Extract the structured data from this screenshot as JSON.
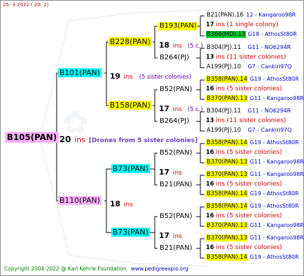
{
  "header": {
    "date": "25-   3-2022 ( 20:   2)"
  },
  "footer": {
    "copyright": "Copyright 2004-2022 @ Karl Kehrle Foundation",
    "url": "www.pedigreeapis.org"
  },
  "root": {
    "id": "B105(PAN)",
    "ins_num": "20",
    "ins_label": "ins",
    "note": "[Drones from 5 sister colonies]"
  },
  "gen1": [
    {
      "id": "B101(PAN)",
      "ins_num": "19",
      "ins_label": "ins",
      "note": "(5 sister colonies)"
    },
    {
      "id": "B110(PAN)",
      "ins_num": "18",
      "ins_label": "ins",
      "note": ""
    }
  ],
  "gen2": [
    {
      "id": "B228(PAN)",
      "ins_num": "18",
      "ins_label": "ins",
      "note": "(5 c.)"
    },
    {
      "id": "B158(PAN)",
      "ins_num": "17",
      "ins_label": "ins",
      "note": "(5 c.)"
    },
    {
      "id": "B73(PAN)",
      "ins_num": "17",
      "ins_label": "ins",
      "note": ""
    },
    {
      "id": "B73(PAN)",
      "ins_num": "17",
      "ins_label": "ins",
      "note": ""
    }
  ],
  "gen3": [
    "B193(PAN)",
    "B264(PJ)",
    "B52(PAN)",
    "B264(PJ)",
    "B52(PAN)",
    "B21(PAN)",
    "B52(PAN)",
    "B21(PAN)"
  ],
  "leaves": [
    {
      "a": "B21(PAN).16",
      "code_a": "12 - Kangaroo98R",
      "ins_num": "17",
      "ins_note": "ins (1 single colony)",
      "b": "B366(MD).13",
      "code_b": "G18 - AthosSt80R"
    },
    {
      "a": "B304(PJ).11",
      "code_a": "G11 - NO6294R",
      "ins_num": "13",
      "ins_note": "ins (11 sister colonies)",
      "b": "A199(PJ).10",
      "code_b": "G7 - Cankiri97Q"
    },
    {
      "a": "B358(PAN).14",
      "code_a": "G19 - AthosSt80R",
      "ins_num": "16",
      "ins_note": "ins (5 sister colonies)",
      "b": "B370(PAN).13",
      "code_b": "G11 - Kangaroo98R"
    },
    {
      "a": "B304(PJ).11",
      "code_a": "G11 - NO6294R",
      "ins_num": "13",
      "ins_note": "ins (11 sister colonies)",
      "b": "A199(PJ).10",
      "code_b": "G7 - Cankiri97Q"
    },
    {
      "a": "B358(PAN).14",
      "code_a": "G19 - AthosSt80R",
      "ins_num": "16",
      "ins_note": "ins (5 sister colonies)",
      "b": "B370(PAN).13",
      "code_b": "G11 - Kangaroo98R"
    },
    {
      "a": "B370(PAN).13",
      "code_a": "G11 - Kangaroo98R",
      "ins_num": "16",
      "ins_note": "ins (5 sister colonies)",
      "b": "B358(PAN).14",
      "code_b": "G19 - AthosSt80R"
    },
    {
      "a": "B358(PAN).14",
      "code_a": "G19 - AthosSt80R",
      "ins_num": "16",
      "ins_note": "ins (5 sister colonies)",
      "b": "B370(PAN).13",
      "code_b": "G11 - Kangaroo98R"
    },
    {
      "a": "B370(PAN).13",
      "code_a": "G11 - Kangaroo98R",
      "ins_num": "16",
      "ins_note": "ins (5 sister colonies)",
      "b": "B358(PAN).14",
      "code_b": "G19 - AthosSt80R"
    }
  ],
  "colors": {
    "pink": "#ffb3ff",
    "cyan": "#00ffff",
    "yellow": "#ffff00",
    "green": "#00cc33",
    "ins_red": "#cc0000",
    "note_purple": "#6600aa",
    "code_blue": "#0000cc",
    "line": "#000000"
  }
}
